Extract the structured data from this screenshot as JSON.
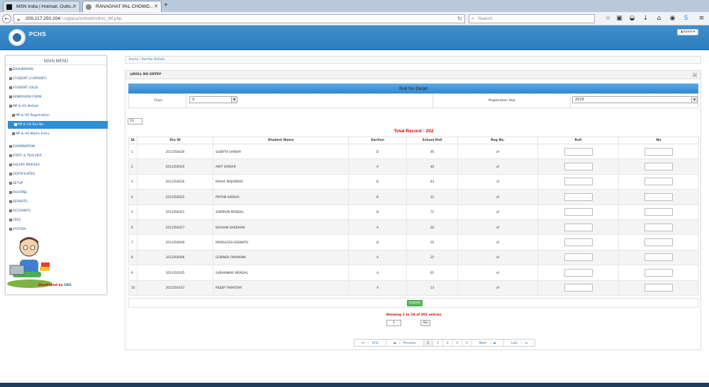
{
  "browser": {
    "tabs": [
      {
        "title": "MSN India | Hotmail, Outlo..."
      },
      {
        "title": "RANAGHAT PAL CHOWD..."
      }
    ],
    "url_host": "209.217.250.204",
    "url_path": "/~siglass/school/rollno_dtl.php",
    "search_placeholder": "Search"
  },
  "app": {
    "brand": "PCHS",
    "admin_label": "Admin"
  },
  "sidebar": {
    "title": "MAIN MENU",
    "items": [
      {
        "label": "DASHBOARD"
      },
      {
        "label": "STUDENT (CURRENT)"
      },
      {
        "label": "STUDENT (OLD)"
      },
      {
        "label": "ADMISSION FORM"
      },
      {
        "label": "MP & HS Details"
      },
      {
        "label": "MP & HS Registration"
      },
      {
        "label": "MP & HS Roll No."
      },
      {
        "label": "MP & HS Marks Entry"
      },
      {
        "label": "EXAMINATION"
      },
      {
        "label": "STAFF & TEACHER"
      },
      {
        "label": "SALARY MODULE"
      },
      {
        "label": "CERTIFICATES"
      },
      {
        "label": "SETUP"
      },
      {
        "label": "ROUTINE"
      },
      {
        "label": "REPORTS"
      },
      {
        "label": "ACCOUNTS"
      },
      {
        "label": "FEES"
      },
      {
        "label": "SYSTEM"
      }
    ],
    "developed_by": "Developed by",
    "developer": "GNS"
  },
  "breadcrumb": {
    "home": "Home",
    "sep": "/",
    "current": "Roll No Details"
  },
  "panel": {
    "heading": "ROLL NO ENTRY",
    "title": "Roll No Detail",
    "class_label": "Class",
    "class_value": "X",
    "reg_year_label": "Registration Year",
    "reg_year_value": "2016",
    "page_size": "10",
    "total_record": "Total Record : 202",
    "columns": [
      "SL",
      "Stu ID",
      "Student Name",
      "Section",
      "School Roll",
      "Reg No.",
      "Roll",
      "No"
    ],
    "rows": [
      {
        "sl": "1",
        "id": "2011050030",
        "name": "SUDIPTA SARKAR",
        "section": "B",
        "roll": "46",
        "reg": "of"
      },
      {
        "sl": "2",
        "id": "2011050029",
        "name": "AMIT SARKAR",
        "section": "A",
        "roll": "46",
        "reg": "of"
      },
      {
        "sl": "3",
        "id": "2011050026",
        "name": "RAHUL MAJUMDAR",
        "section": "B",
        "roll": "63",
        "reg": "of"
      },
      {
        "sl": "4",
        "id": "2011050025",
        "name": "PRITAM SARKAR",
        "section": "B",
        "roll": "12",
        "reg": "of"
      },
      {
        "sl": "5",
        "id": "2011050021",
        "name": "SOMIRON MONDAL",
        "section": "B",
        "roll": "71",
        "reg": "of"
      },
      {
        "sl": "6",
        "id": "2011050017",
        "name": "KOUSHIK BARDHAN",
        "section": "A",
        "roll": "26",
        "reg": "of"
      },
      {
        "sl": "7",
        "id": "2011050009",
        "name": "MRIDULESH DEBNATH",
        "section": "B",
        "roll": "26",
        "reg": "of"
      },
      {
        "sl": "8",
        "id": "2011050006",
        "name": "GOBINDA PRAMANIK",
        "section": "A",
        "roll": "25",
        "reg": "of"
      },
      {
        "sl": "9",
        "id": "2011050165",
        "name": "SUBHANKAR MONDAL",
        "section": "A",
        "roll": "65",
        "reg": "of"
      },
      {
        "sl": "10",
        "id": "2011050167",
        "name": "RAJDIP TARAFDAR",
        "section": "A",
        "roll": "13",
        "reg": "of"
      }
    ],
    "submit_label": "Submit",
    "showing": "Showing 1 to 10 of 202 entries",
    "goto_value": "1",
    "go_label": "Go",
    "pager": {
      "first": "First",
      "prev": "Previous",
      "pages": [
        "1",
        "2",
        "3",
        "4",
        "5"
      ],
      "next": "Next",
      "last": "Last"
    }
  }
}
